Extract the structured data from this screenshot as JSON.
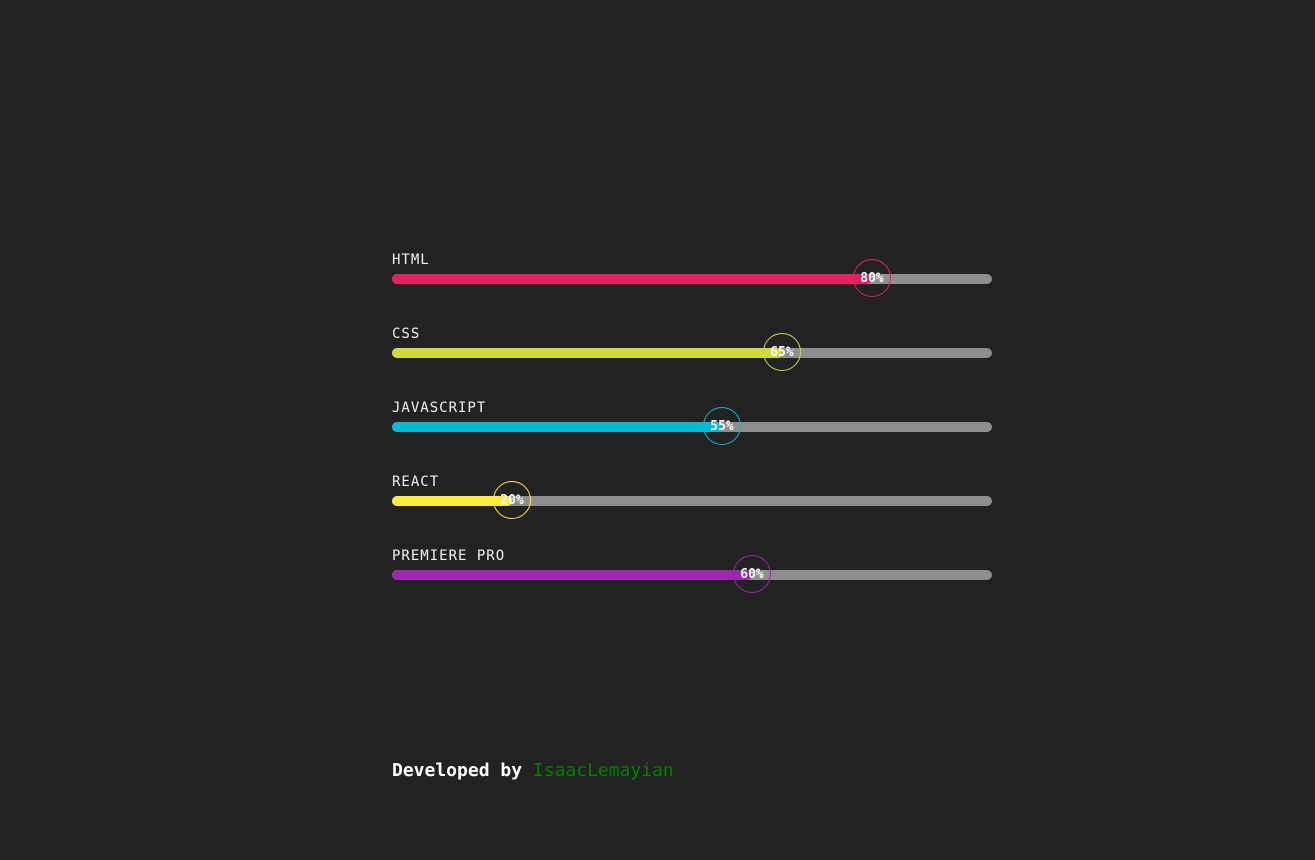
{
  "skills": [
    {
      "name": "HTML",
      "percent": 80,
      "percent_label": "80%",
      "color": "#e91e63"
    },
    {
      "name": "CSS",
      "percent": 65,
      "percent_label": "65%",
      "color": "#cddc39"
    },
    {
      "name": "JAVASCRIPT",
      "percent": 55,
      "percent_label": "55%",
      "color": "#00bcd4"
    },
    {
      "name": "REACT",
      "percent": 20,
      "percent_label": "20%",
      "color": "#ffeb3b"
    },
    {
      "name": "PREMIERE PRO",
      "percent": 60,
      "percent_label": "60%",
      "color": "#9c27b0"
    }
  ],
  "track_color": "#8f8e8c",
  "footer": {
    "prefix": "Developed by",
    "author": "IsaacLemayian",
    "author_color": "#008000",
    "text_color": "#ffffff"
  }
}
